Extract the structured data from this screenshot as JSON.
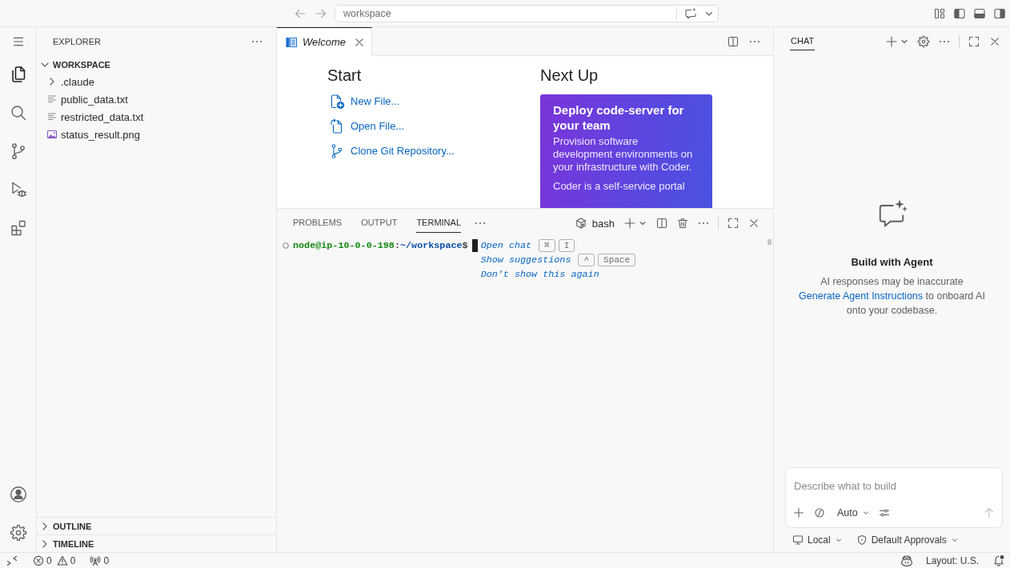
{
  "title_bar": {
    "command_center": "workspace"
  },
  "activity_bar": {
    "items": [
      {
        "selected": true
      },
      {
        "selected": false
      },
      {
        "selected": false
      },
      {
        "selected": false
      },
      {
        "selected": false
      }
    ]
  },
  "sidebar": {
    "title": "EXPLORER",
    "sections": [
      {
        "title": "WORKSPACE",
        "expanded": true,
        "items": [
          {
            "name": ".claude",
            "kind": "folder",
            "expanded": false
          },
          {
            "name": "public_data.txt",
            "kind": "text"
          },
          {
            "name": "restricted_data.txt",
            "kind": "text"
          },
          {
            "name": "status_result.png",
            "kind": "image"
          }
        ]
      },
      {
        "title": "OUTLINE",
        "expanded": false
      },
      {
        "title": "TIMELINE",
        "expanded": false
      }
    ]
  },
  "editor": {
    "tabs": [
      {
        "label": "Welcome",
        "selected": true
      }
    ],
    "welcome": {
      "start": {
        "title": "Start",
        "links": [
          "New File...",
          "Open File...",
          "Clone Git Repository..."
        ]
      },
      "next_up": {
        "title": "Next Up",
        "card": {
          "title": "Deploy code-server for your team",
          "paragraphs": [
            "Provision software development environments on your infrastructure with Coder.",
            "Coder is a self-service portal"
          ]
        }
      }
    }
  },
  "panel": {
    "tabs": [
      {
        "label": "PROBLEMS",
        "selected": false
      },
      {
        "label": "OUTPUT",
        "selected": false
      },
      {
        "label": "TERMINAL",
        "selected": true
      }
    ],
    "terminal_name": "bash",
    "terminal": {
      "prompt": {
        "user_host": "node@ip-10-0-0-198",
        "separator": ":",
        "path": "~/workspace",
        "symbol": "$"
      },
      "hints": [
        {
          "text": "Open chat",
          "keys": [
            "⌘",
            "I"
          ]
        },
        {
          "text": "Show suggestions",
          "keys": [
            "^",
            "Space"
          ]
        },
        {
          "text": "Don't show this again"
        }
      ]
    }
  },
  "chat": {
    "tabs": [
      {
        "label": "CHAT",
        "selected": true
      }
    ],
    "empty_state": {
      "title": "Build with Agent",
      "note": "AI responses may be inaccurate",
      "link": "Generate Agent Instructions",
      "after_link": "to onboard AI onto your codebase."
    },
    "input": {
      "placeholder": "Describe what to build",
      "mode": "Auto",
      "send_disabled": true
    },
    "footer": [
      "Local",
      "Default Approvals"
    ]
  },
  "status_bar": {
    "errors": "0",
    "warnings": "0",
    "ports": "0",
    "layout": "Layout: U.S.",
    "notifications_unread": true
  }
}
